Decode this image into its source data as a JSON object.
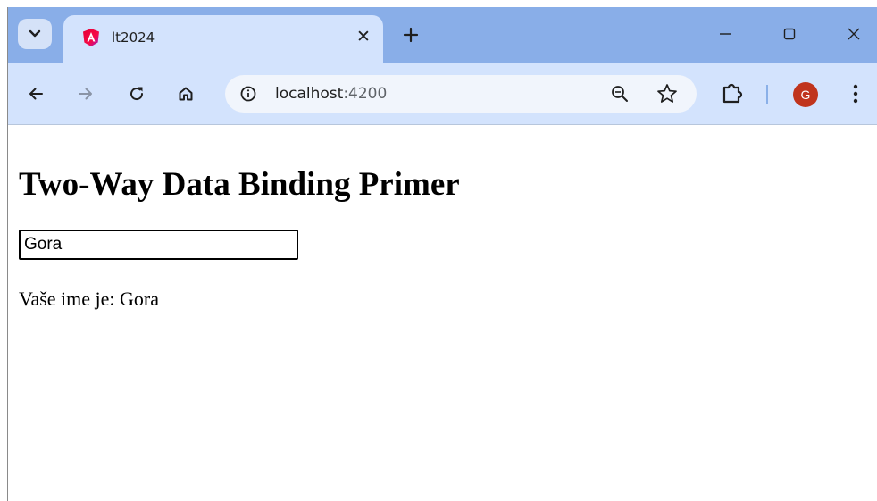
{
  "browser": {
    "tab": {
      "title": "lt2024",
      "favicon": "angular-logo-icon"
    },
    "new_tab_icon": "plus-icon",
    "address": {
      "host": "localhost",
      "port": ":4200"
    },
    "profile_initial": "G",
    "colors": {
      "tabbar": "#89aee8",
      "toolbar": "#d3e3fd",
      "avatar": "#c0341d"
    }
  },
  "page": {
    "title": "Two-Way Data Binding Primer",
    "input_value": "Gora",
    "greeting_prefix": "Vaše ime je: ",
    "greeting_name": "Gora"
  }
}
